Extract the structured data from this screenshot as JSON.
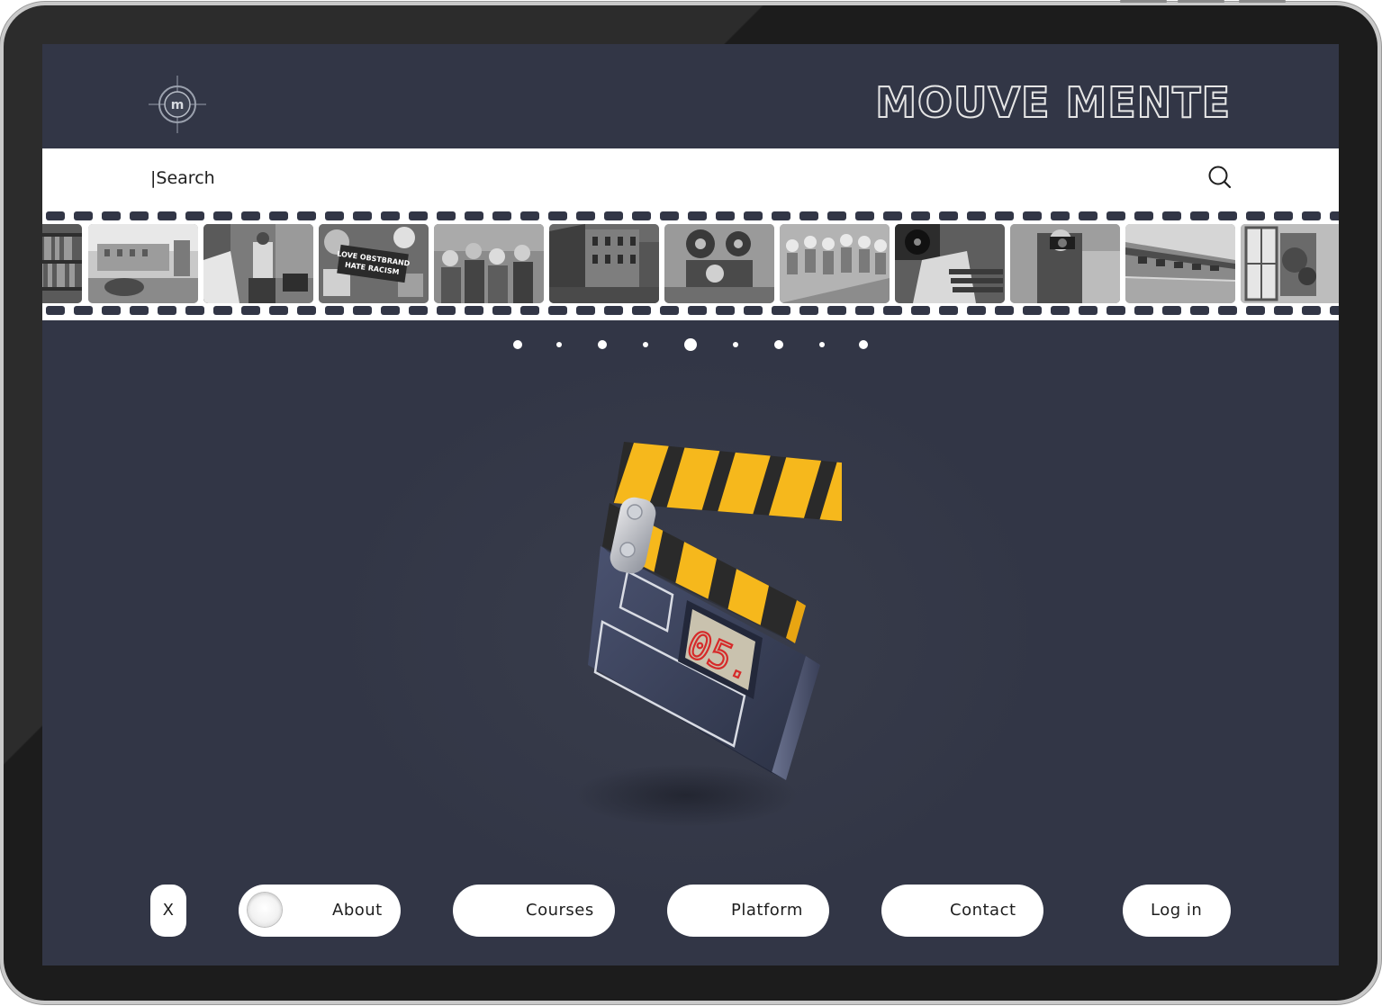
{
  "brand": {
    "name": "MOUVE MENTE",
    "logo_letter": "m"
  },
  "search": {
    "placeholder": "|Search",
    "icon": "search-icon"
  },
  "film_strip": {
    "frames": [
      "bookshelf",
      "vintage-car-street",
      "street-crowd-newspaper",
      "sticker-wall",
      "crowd-cheering",
      "canal-buildings",
      "film-projector",
      "dancers-row",
      "vinyl-records",
      "photographer-camera",
      "train-platform",
      "greenhouse-door"
    ],
    "sticker_text": [
      "LOVE OBSTBRAND",
      "HATE RACISM"
    ]
  },
  "carousel": {
    "dot_count": 9,
    "active_index": 4
  },
  "hero": {
    "clapper_display": "05.",
    "colors": {
      "stripe_yellow": "#f6b81c",
      "stripe_dark": "#2a2a2a",
      "slate_body": "#3a4156",
      "digit_red": "#d62a2a"
    }
  },
  "nav": {
    "close_label": "X",
    "about_label": "About",
    "courses_label": "Courses",
    "platform_label": "Platform",
    "contact_label": "Contact",
    "login_label": "Log in"
  },
  "colors": {
    "background": "#323646",
    "surface": "#ffffff",
    "text": "#1e1e1e"
  }
}
